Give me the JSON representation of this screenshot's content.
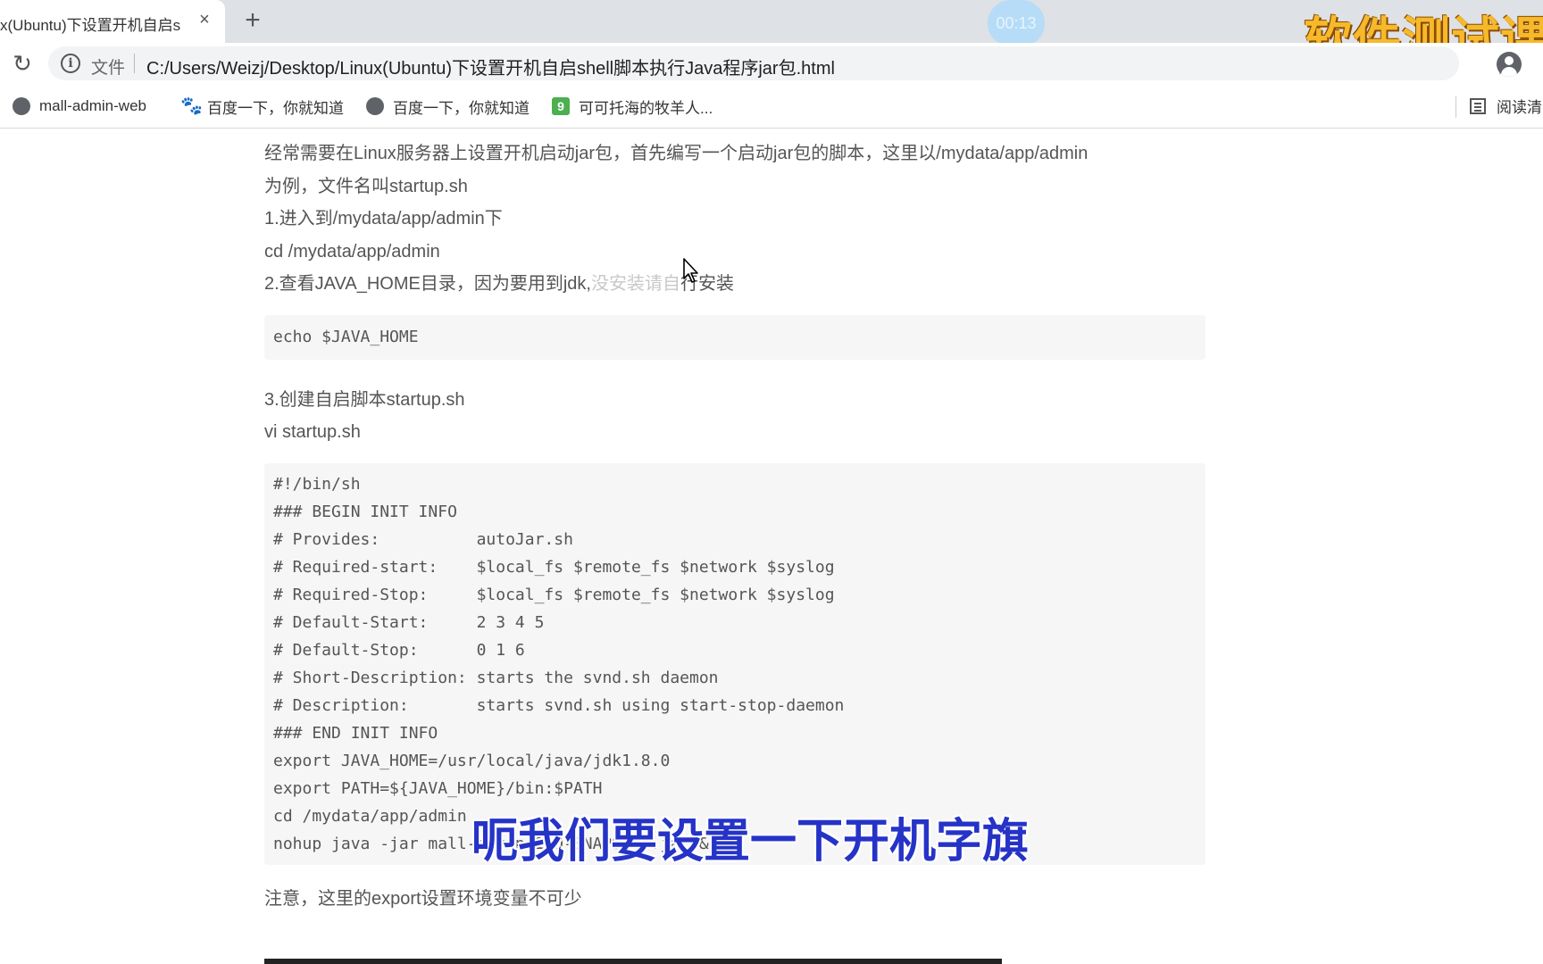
{
  "browser": {
    "tab": {
      "title": "x(Ubuntu)下设置开机自启s",
      "close_icon": "×"
    },
    "new_tab_icon": "+",
    "timer": "00:13",
    "watermark": "软件测试课",
    "omnibox": {
      "site_label": "文件",
      "url": "C:/Users/Weizj/Desktop/Linux(Ubuntu)下设置开机自启shell脚本执行Java程序jar包.html"
    },
    "reload_icon": "↻",
    "star_icon": "☆",
    "info_icon": "i"
  },
  "bookmarks": [
    {
      "label": "mall-admin-web",
      "icon": "globe-icon"
    },
    {
      "label": "百度一下，你就知道",
      "icon": "paw-icon",
      "glyph": "🐾"
    },
    {
      "label": "百度一下，你就知道",
      "icon": "globe-icon"
    },
    {
      "label": "可可托海的牧羊人...",
      "icon": "green-square-icon",
      "glyph": "9"
    }
  ],
  "reading_list": "阅读清",
  "article": {
    "intro_1": "经常需要在Linux服务器上设置开机启动jar包，首先编写一个启动jar包的脚本，这里以/mydata/app/admin",
    "intro_2": "为例，文件名叫startup.sh",
    "step1": "1.进入到/mydata/app/admin下",
    "step1_cmd": "cd /mydata/app/admin",
    "step2_main": "2.查看JAVA_HOME目录，因为要用到jdk,",
    "step2_faded": "没安装请自",
    "step2_end": "行安装",
    "code1": "echo $JAVA_HOME",
    "step3": "3.创建自启脚本startup.sh",
    "step3_cmd": "vi startup.sh",
    "code2_lines": [
      "#!/bin/sh",
      "### BEGIN INIT INFO",
      "# Provides:          autoJar.sh",
      "# Required-start:    $local_fs $remote_fs $network $syslog",
      "# Required-Stop:     $local_fs $remote_fs $network $syslog",
      "# Default-Start:     2 3 4 5",
      "# Default-Stop:      0 1 6",
      "# Short-Description: starts the svnd.sh daemon",
      "# Description:       starts svnd.sh using start-stop-daemon",
      "### END INIT INFO",
      "export JAVA_HOME=/usr/local/java/jdk1.8.0",
      "export PATH=${JAVA_HOME}/bin:$PATH",
      "cd /mydata/app/admin",
      "nohup java -jar mall-admin-1.0-SNAPSHOT.jar &"
    ],
    "note": "注意，这里的export设置环境变量不可少"
  },
  "subtitle": "呃我们要设置一下开机字旗"
}
